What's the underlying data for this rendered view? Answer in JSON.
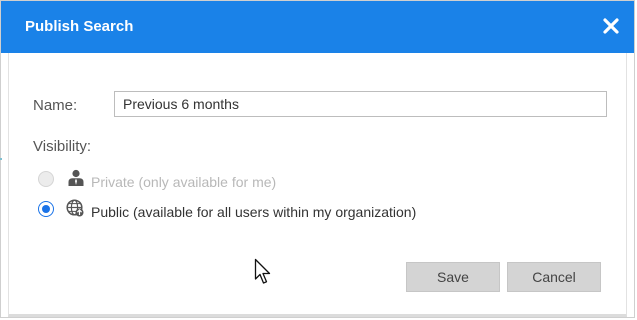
{
  "dialog": {
    "title": "Publish Search",
    "close_icon": "close-icon",
    "header_color": "#1a82e8"
  },
  "form": {
    "name_label": "Name:",
    "name_value": "Previous 6 months",
    "visibility_label": "Visibility:",
    "options": [
      {
        "label": "Private (only available for me)",
        "icon": "person-icon",
        "selected": false,
        "disabled": true
      },
      {
        "label": "Public (available for all users within my organization)",
        "icon": "globe-icon",
        "selected": true,
        "disabled": false
      }
    ]
  },
  "buttons": {
    "save_label": "Save",
    "cancel_label": "Cancel"
  },
  "accent_color": "#1a73e8"
}
